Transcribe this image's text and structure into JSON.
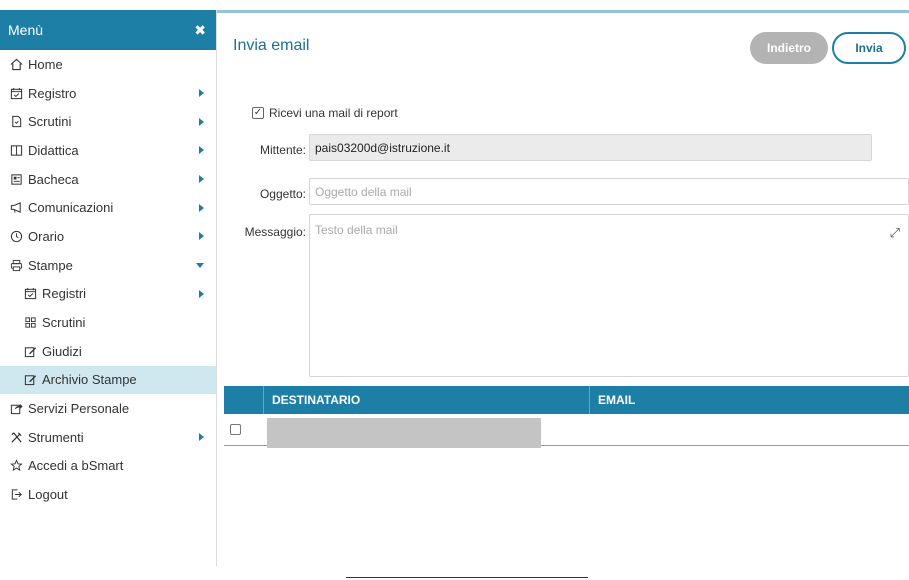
{
  "sidebar": {
    "header": "Menù",
    "close_glyph": "✖",
    "items": [
      {
        "label": "Home",
        "icon": "home-icon"
      },
      {
        "label": "Registro",
        "icon": "calendar-check-icon"
      },
      {
        "label": "Scrutini",
        "icon": "document-icon"
      },
      {
        "label": "Didattica",
        "icon": "book-icon"
      },
      {
        "label": "Bacheca",
        "icon": "newspaper-icon"
      },
      {
        "label": "Comunicazioni",
        "icon": "megaphone-icon"
      },
      {
        "label": "Orario",
        "icon": "clock-icon"
      },
      {
        "label": "Stampe",
        "icon": "printer-icon"
      },
      {
        "label": "Registri",
        "icon": "calendar-check-icon"
      },
      {
        "label": "Scrutini",
        "icon": "grid-icon"
      },
      {
        "label": "Giudizi",
        "icon": "edit-icon"
      },
      {
        "label": "Archivio Stampe",
        "icon": "edit-icon"
      },
      {
        "label": "Servizi Personale",
        "icon": "share-icon"
      },
      {
        "label": "Strumenti",
        "icon": "tools-icon"
      },
      {
        "label": "Accedi a bSmart",
        "icon": "star-icon"
      },
      {
        "label": "Logout",
        "icon": "logout-icon"
      }
    ]
  },
  "main": {
    "title": "Invia email",
    "back_label": "Indietro",
    "send_label": "Invia",
    "report_label": "Ricevi una mail di report",
    "sender_label": "Mittente:",
    "sender_value": "pais03200d@istruzione.it",
    "subject_label": "Oggetto:",
    "subject_placeholder": "Oggetto della mail",
    "message_label": "Messaggio:",
    "message_placeholder": "Testo della mail",
    "expand_glyph": "⤢"
  },
  "table": {
    "columns": [
      "DESTINATARIO",
      "EMAIL"
    ]
  },
  "colors": {
    "accent": "#1d7fa5",
    "title": "#1d6f94",
    "active_bg": "#cfe7ee"
  }
}
